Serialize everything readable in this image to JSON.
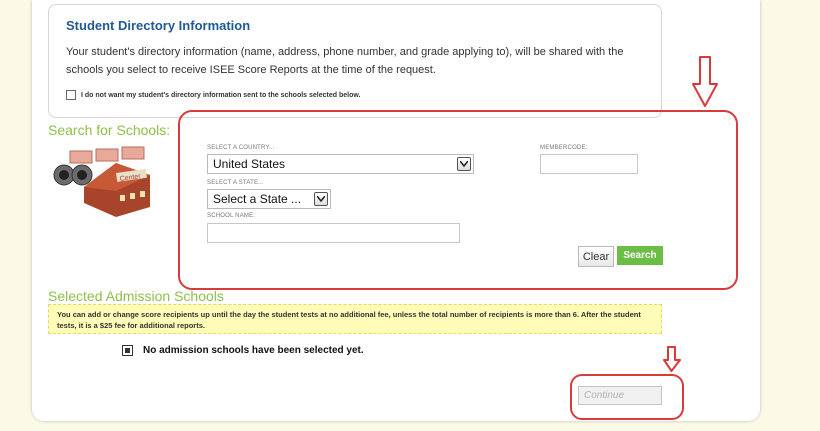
{
  "directory": {
    "title": "Student Directory Information",
    "body": "Your student's directory information (name, address, phone number, and grade applying to), will be shared with the schools you select to receive ISEE Score Reports at the time of the request.",
    "optout_label": "I do not want my student's directory information sent to the schools selected below."
  },
  "search": {
    "heading": "Search for Schools:",
    "country_label": "SELECT A COUNTRY...",
    "country_value": "United States",
    "state_label": "SELECT A STATE...",
    "state_value": "Select a State ...",
    "school_name_label": "SCHOOL NAME:",
    "school_name_value": "",
    "membercode_label": "MEMBERCODE:",
    "membercode_value": "",
    "clear_label": "Clear",
    "search_label": "Search"
  },
  "selected": {
    "heading": "Selected Admission Schools",
    "notice": "You can add or change score recipients up until the day the student tests at no additional fee, unless the total number of recipients is more than 6. After the student tests, it is a $25 fee for additional reports.",
    "empty_message": "No admission schools have been selected yet.",
    "continue_label": "Continue"
  },
  "colors": {
    "accent_green": "#8cc14b",
    "button_green": "#6cbd45",
    "title_blue": "#1f5a96",
    "annotation_red": "#d93a3a",
    "notice_yellow": "#fefcb7"
  },
  "icons": [
    "school-search-icon",
    "down-arrow-icon",
    "chevron-down-icon",
    "radio-icon"
  ]
}
